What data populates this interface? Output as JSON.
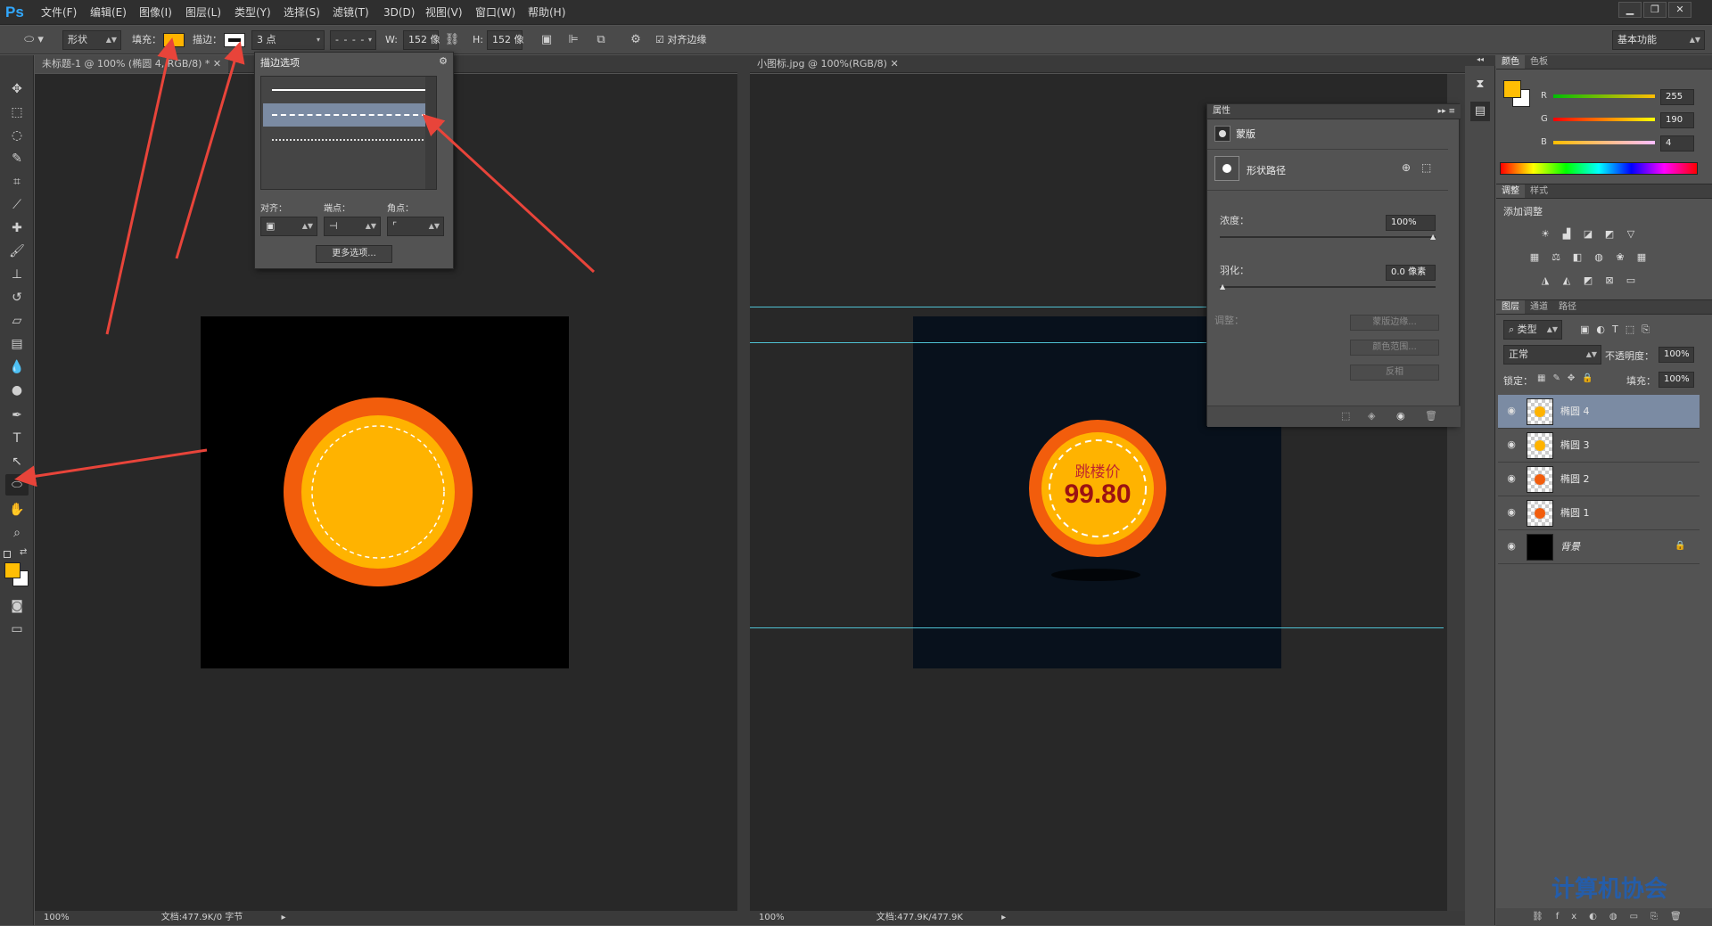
{
  "app": {
    "logo": "Ps"
  },
  "menu": [
    "文件(F)",
    "编辑(E)",
    "图像(I)",
    "图层(L)",
    "类型(Y)",
    "选择(S)",
    "滤镜(T)",
    "3D(D)",
    "视图(V)",
    "窗口(W)",
    "帮助(H)"
  ],
  "window_controls": [
    "minimize-icon",
    "restore-icon",
    "close-icon"
  ],
  "options": {
    "mode": "形状",
    "fill_label": "填充：",
    "fill_color": "#ffb300",
    "stroke_label": "描边：",
    "stroke_width": "3 点",
    "w_label": "W:",
    "w_value": "152 像",
    "h_label": "H:",
    "h_value": "152 像",
    "align_edges": "对齐边缘",
    "workspace": "基本功能"
  },
  "doc_left": {
    "tab": "未标题-1 @ 100% (椭圆 4, RGB/8) *",
    "zoom": "100%",
    "doc_info": "文档:477.9K/0 字节"
  },
  "doc_right": {
    "tab": "小图标.jpg @ 100%(RGB/8)",
    "zoom": "100%",
    "doc_info": "文档:477.9K/477.9K",
    "badge_title": "跳楼价",
    "badge_price": "99.80"
  },
  "stroke_popup": {
    "title": "描边选项",
    "align_label": "对齐：",
    "caps_label": "端点：",
    "corners_label": "角点：",
    "more_button": "更多选项..."
  },
  "properties": {
    "title": "属性",
    "mask_label": "蒙版",
    "shape_path": "形状路径",
    "density_label": "浓度：",
    "density_value": "100%",
    "density_level": 1.0,
    "feather_label": "羽化：",
    "feather_value": "0.0 像素",
    "feather_level": 0.0,
    "adjust_label": "调整：",
    "btn_mask_edge": "蒙版边缘...",
    "btn_color_range": "颜色范围...",
    "btn_invert": "反相"
  },
  "color_panel": {
    "tabs": [
      "颜色",
      "色板"
    ],
    "r_label": "R",
    "r_value": "255",
    "g_label": "G",
    "g_value": "190",
    "b_label": "B",
    "b_value": "4",
    "foreground": "#ffbe04",
    "background": "#ffffff"
  },
  "adjust_panel": {
    "tabs": [
      "调整",
      "样式"
    ],
    "title": "添加调整"
  },
  "layers_panel": {
    "tabs": [
      "图层",
      "通道",
      "路径"
    ],
    "filter": "类型",
    "blend_mode": "正常",
    "opacity_label": "不透明度：",
    "opacity_value": "100%",
    "lock_label": "锁定：",
    "fill_label": "填充：",
    "fill_value": "100%",
    "layers": [
      {
        "name": "椭圆 4",
        "selected": true
      },
      {
        "name": "椭圆 3",
        "selected": false
      },
      {
        "name": "椭圆 2",
        "selected": false
      },
      {
        "name": "椭圆 1",
        "selected": false
      },
      {
        "name": "背景",
        "selected": false
      }
    ]
  },
  "watermark": "计算机协会"
}
